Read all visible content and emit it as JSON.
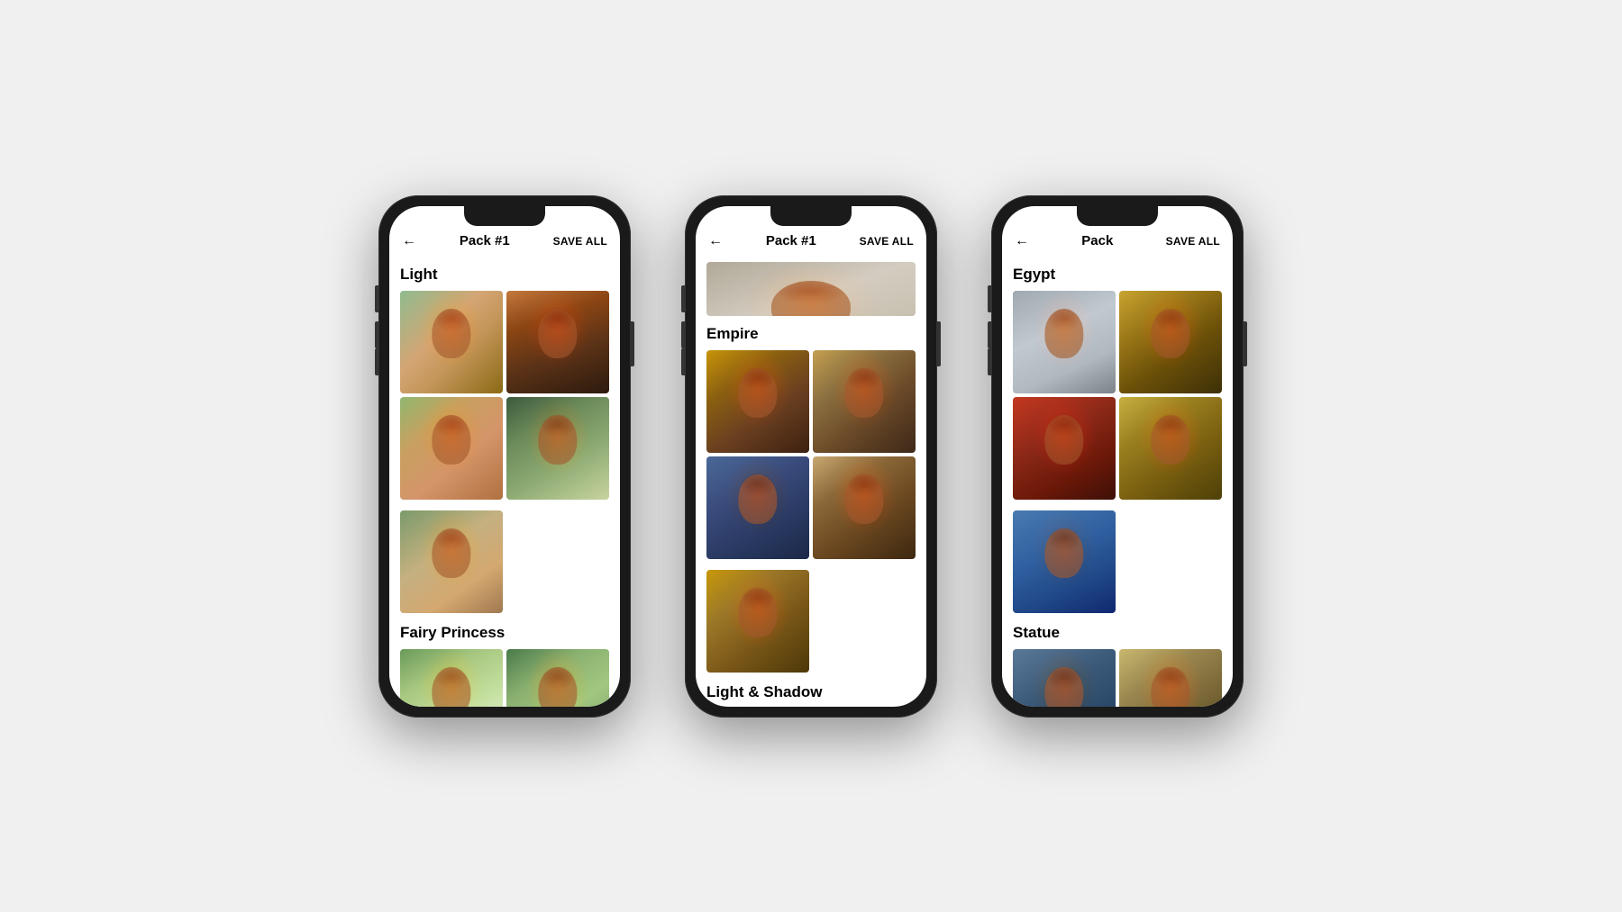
{
  "phones": [
    {
      "id": "phone-left",
      "header": {
        "back_label": "←",
        "title": "Pack #1",
        "save_all": "SAVE ALL"
      },
      "sections": [
        {
          "heading": "Light",
          "images": [
            {
              "id": "p1-img1",
              "alt": "Woman in park autumn"
            },
            {
              "id": "p1-img2",
              "alt": "Woman portrait autumn"
            },
            {
              "id": "p1-img3",
              "alt": "Woman in meadow"
            },
            {
              "id": "p1-img4",
              "alt": "Woman in forest"
            },
            {
              "id": "p1-img5",
              "alt": "Woman portrait classical",
              "single": true
            }
          ]
        },
        {
          "heading": "Fairy Princess",
          "images": [
            {
              "id": "p1-fp1",
              "alt": "Fairy princess forest"
            },
            {
              "id": "p1-fp2",
              "alt": "Fairy princess portrait"
            }
          ]
        }
      ]
    },
    {
      "id": "phone-middle",
      "header": {
        "back_label": "←",
        "title": "Pack #1",
        "save_all": "SAVE ALL"
      },
      "sections": [
        {
          "heading": "",
          "images": [
            {
              "id": "p2-img0",
              "alt": "Crown detail",
              "single": true,
              "wide": true
            }
          ]
        },
        {
          "heading": "Empire",
          "images": [
            {
              "id": "p2-img1",
              "alt": "Empire portrait 1"
            },
            {
              "id": "p2-img2",
              "alt": "Empire portrait 2"
            },
            {
              "id": "p2-img3",
              "alt": "Empire portrait 3"
            },
            {
              "id": "p2-img4",
              "alt": "Empire portrait 4"
            },
            {
              "id": "p2-img5",
              "alt": "Empire portrait 5",
              "single": true
            }
          ]
        },
        {
          "heading": "Light & Shadow",
          "images": []
        }
      ]
    },
    {
      "id": "phone-right",
      "header": {
        "back_label": "←",
        "title": "Pack",
        "save_all": "SAVE ALL"
      },
      "sections": [
        {
          "heading": "Egypt",
          "images": [
            {
              "id": "p3-egypt1",
              "alt": "Egypt portrait silver"
            },
            {
              "id": "p3-egypt2",
              "alt": "Egypt portrait gold"
            },
            {
              "id": "p3-egypt3",
              "alt": "Egypt portrait red"
            },
            {
              "id": "p3-egypt4",
              "alt": "Egypt portrait headdress"
            },
            {
              "id": "p3-egypt5",
              "alt": "Egypt portrait blue",
              "single": true
            }
          ]
        },
        {
          "heading": "Statue",
          "images": [
            {
              "id": "p3-statue1",
              "alt": "Statue portrait grey"
            },
            {
              "id": "p3-statue2",
              "alt": "Statue portrait gold"
            }
          ]
        }
      ]
    }
  ]
}
